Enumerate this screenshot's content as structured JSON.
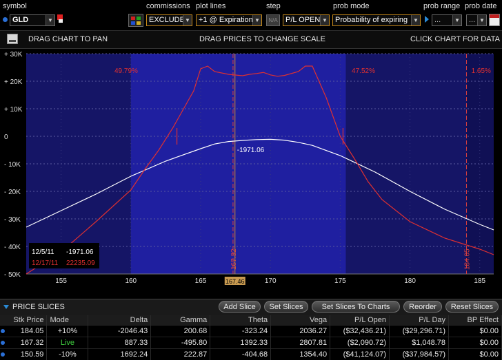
{
  "header": {
    "symbol_label": "symbol",
    "symbol_value": "GLD",
    "commissions_label": "commissions",
    "commissions_value": "EXCLUDE",
    "plot_lines_label": "plot lines",
    "plot_lines_value": "+1 @ Expiration",
    "step_label": "step",
    "step_value": "N/A",
    "step_mode_value": "P/L OPEN",
    "prob_mode_label": "prob mode",
    "prob_mode_value": "Probability of expiring",
    "prob_range_label": "prob range",
    "prob_range_value": "...",
    "prob_date_label": "prob date",
    "prob_date_value": "..."
  },
  "toolbar": {
    "drag_pan": "DRAG CHART TO PAN",
    "drag_prices": "DRAG PRICES TO CHANGE SCALE",
    "click_chart": "CLICK CHART FOR DATA"
  },
  "chart_data": {
    "type": "line",
    "x_ticks": [
      "155",
      "160",
      "165",
      "170",
      "175",
      "180",
      "185"
    ],
    "y_ticks": [
      "+ 30K",
      "+ 20K",
      "+ 10K",
      "0",
      "- 10K",
      "- 20K",
      "- 30K",
      "- 40K",
      "- 50K"
    ],
    "xlim": [
      152.5,
      186
    ],
    "ylim": [
      -50000,
      30000
    ],
    "prob_labels": [
      "49.79%",
      "47.52%",
      "1.65%"
    ],
    "vlines": [
      {
        "x": 167.32,
        "label": "167.32",
        "color": "#d84040"
      },
      {
        "x": 184.05,
        "label": "184.05",
        "color": "#d84040"
      }
    ],
    "current_price_label": "167.46",
    "current_price": 167.46,
    "current_value_label": "-1971.06",
    "legend": [
      {
        "date": "12/5/11",
        "value": "-1971.06",
        "color": "#ffffff"
      },
      {
        "date": "12/17/11",
        "value": "22235.09",
        "color": "#e03030"
      }
    ],
    "series": [
      {
        "name": "12/5/11",
        "color": "#ffffff",
        "x": [
          152.5,
          155,
          157.5,
          160,
          162.5,
          165,
          166,
          167,
          168,
          169,
          170,
          171,
          172,
          173,
          175,
          177.5,
          180,
          182.5,
          185,
          186
        ],
        "y": [
          -33000,
          -27000,
          -21000,
          -14500,
          -9000,
          -4500,
          -2800,
          -1900,
          -1500,
          -1200,
          -1100,
          -1400,
          -2200,
          -3300,
          -7000,
          -13000,
          -20000,
          -26500,
          -32000,
          -34000
        ]
      },
      {
        "name": "12/17/11",
        "color": "#e03030",
        "x": [
          152.5,
          155,
          157.5,
          160,
          161,
          162,
          163,
          164,
          164.5,
          165,
          165.5,
          166,
          167,
          168,
          168.5,
          169,
          169.5,
          170,
          170.5,
          171,
          172,
          172.5,
          173,
          174,
          175,
          176,
          177,
          178,
          180,
          182.5,
          185,
          186
        ],
        "y": [
          -50000,
          -42000,
          -31000,
          -19500,
          -12000,
          -5000,
          3000,
          12000,
          16500,
          24500,
          25500,
          23500,
          22500,
          22000,
          22500,
          22800,
          23200,
          22300,
          21800,
          22100,
          23500,
          25500,
          25500,
          14000,
          0,
          -8000,
          -16500,
          -23000,
          -31000,
          -37000,
          -41000,
          -43000
        ]
      }
    ]
  },
  "price_slices": {
    "title": "PRICE SLICES",
    "buttons": [
      "Add Slice",
      "Set Slices",
      "Set Slices To Charts",
      "Reorder",
      "Reset Slices"
    ],
    "columns": [
      "Stk Price",
      "Mode",
      "Delta",
      "Gamma",
      "Theta",
      "Vega",
      "P/L Open",
      "P/L Day",
      "BP Effect"
    ],
    "rows": [
      {
        "stk": "184.05",
        "mode": "+10%",
        "delta": "-2046.43",
        "gamma": "200.68",
        "theta": "-323.24",
        "vega": "2036.27",
        "pl_open": "($32,436.21)",
        "pl_day": "($29,296.71)",
        "bp": "$0.00"
      },
      {
        "stk": "167.32",
        "mode": "Live",
        "delta": "887.33",
        "gamma": "-495.80",
        "theta": "1392.33",
        "vega": "2807.81",
        "pl_open": "($2,090.72)",
        "pl_day": "$1,048.78",
        "bp": "$0.00"
      },
      {
        "stk": "150.59",
        "mode": "-10%",
        "delta": "1692.24",
        "gamma": "222.87",
        "theta": "-404.68",
        "vega": "1354.40",
        "pl_open": "($41,124.07)",
        "pl_day": "($37,984.57)",
        "bp": "$0.00"
      }
    ]
  }
}
